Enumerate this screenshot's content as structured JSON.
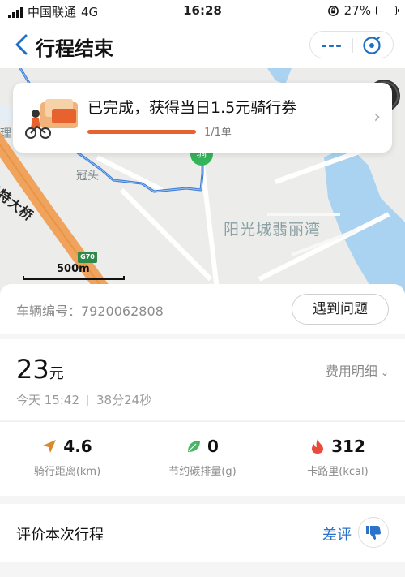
{
  "status_bar": {
    "carrier": "中国联通",
    "network": "4G",
    "time": "16:28",
    "battery": "27%",
    "battery_level": 0.27
  },
  "nav": {
    "title": "行程结束",
    "accent_color": "#1f6fc4"
  },
  "map": {
    "labels": {
      "bridge": "口特大桥",
      "village": "冠头",
      "community": "阳光城翡丽湾",
      "edge": "理",
      "highway": "G70",
      "start_marker": "骑"
    },
    "scale": "500m"
  },
  "reward": {
    "title": "已完成，获得当日1.5元骑行券",
    "progress_current": "1",
    "progress_total": "/1单",
    "progress_fraction": 1.0,
    "accent_color": "#e8622f"
  },
  "vehicle": {
    "label": "车辆编号：7920062808",
    "problem_button": "遇到问题"
  },
  "fare": {
    "amount": "23",
    "unit": "元",
    "detail_link": "费用明细",
    "date": "今天 15:42",
    "duration": "38分24秒"
  },
  "stats": [
    {
      "icon": "navigation-arrow-icon",
      "value": "4.6",
      "label": "骑行距离(km)"
    },
    {
      "icon": "leaf-icon",
      "value": "0",
      "label": "节约碳排量(g)"
    },
    {
      "icon": "flame-icon",
      "value": "312",
      "label": "卡路里(kcal)"
    }
  ],
  "review": {
    "title": "评价本次行程",
    "bad_review": "差评"
  }
}
